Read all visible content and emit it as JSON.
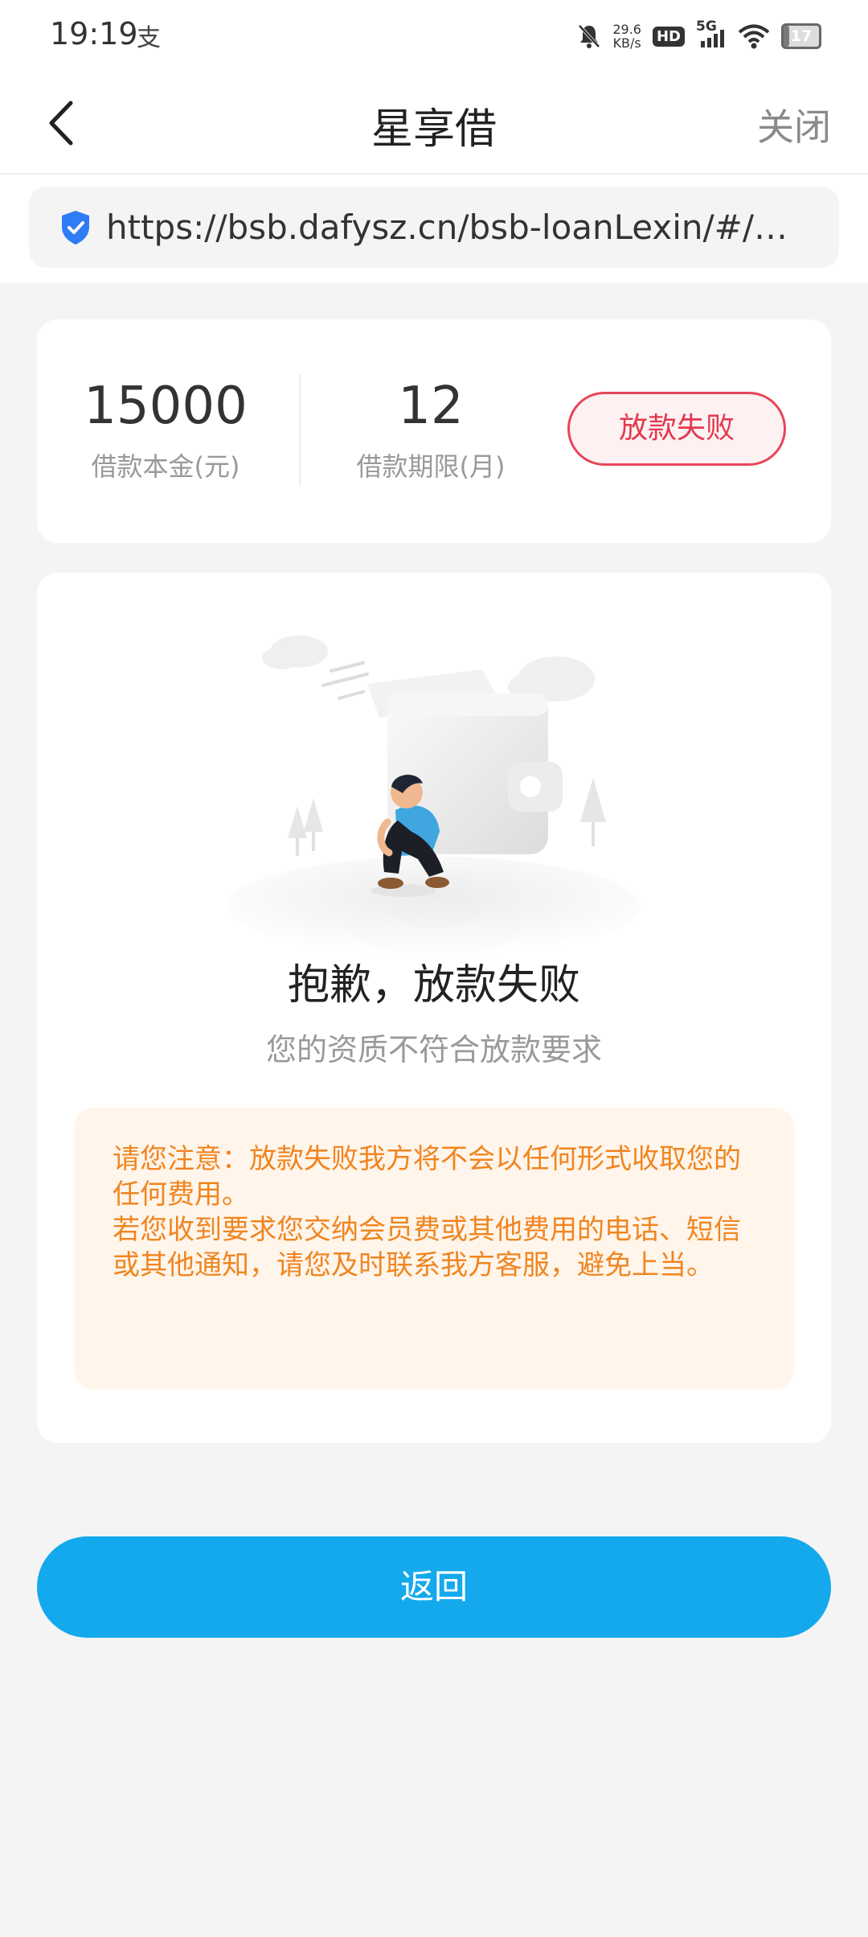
{
  "status_bar": {
    "time": "19:19",
    "alipay_glyph": "支",
    "net_speed_value": "29.6",
    "net_speed_unit": "KB/s",
    "hd": "HD",
    "network": "5G",
    "battery": "17",
    "battery_level_percent": 17,
    "icons": [
      "mute-bell-icon",
      "signal-icon",
      "wifi-icon",
      "battery-icon"
    ]
  },
  "nav": {
    "title": "星享借",
    "close_label": "关闭",
    "back_icon": "back-arrow-icon"
  },
  "url": {
    "text": "https://bsb.dafysz.cn/bsb-loanLexin/#/e…",
    "icon": "security-shield-icon"
  },
  "loan": {
    "amount": "15000",
    "amount_label": "借款本金(元)",
    "term": "12",
    "term_label": "借款期限(月)",
    "status": "放款失败"
  },
  "result": {
    "illustration": "person-sitting-by-wallet-illustration",
    "title": "抱歉，放款失败",
    "subtitle": "您的资质不符合放款要求",
    "notice_line1": "请您注意：放款失败我方将不会以任何形式收取您的任何费用。",
    "notice_line2": "若您收到要求您交纳会员费或其他费用的电话、短信或其他通知，请您及时联系我方客服，避免上当。"
  },
  "actions": {
    "return_label": "返回"
  },
  "colors": {
    "primary": "#14a9ec",
    "failure": "#e3394e",
    "notice_text": "#f08520",
    "notice_bg": "#fff5eb",
    "page_bg": "#f4f4f4"
  }
}
